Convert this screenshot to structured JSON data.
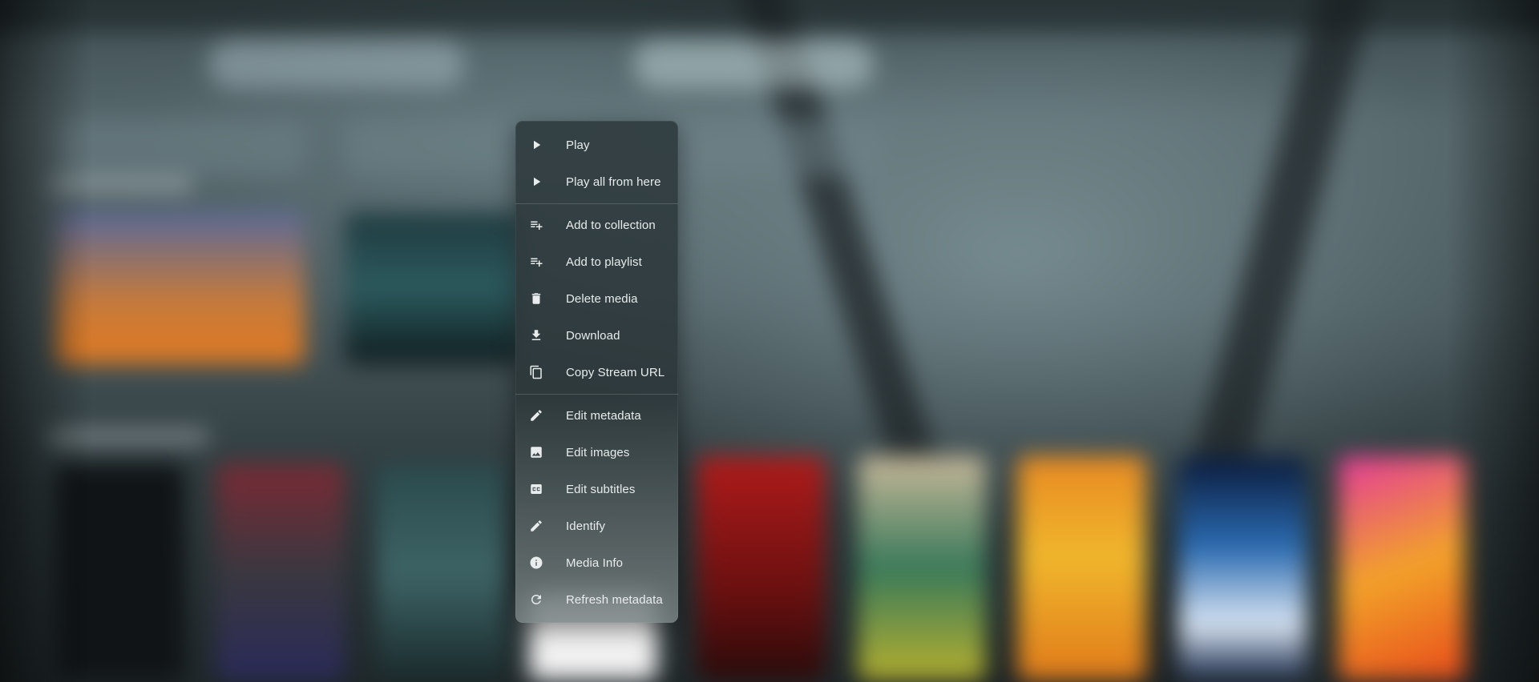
{
  "context_menu": {
    "items": [
      {
        "label": "Play",
        "icon": "play-icon"
      },
      {
        "label": "Play all from here",
        "icon": "play-icon"
      },
      {
        "label": "Add to collection",
        "icon": "playlist-add-icon"
      },
      {
        "label": "Add to playlist",
        "icon": "playlist-add-icon"
      },
      {
        "label": "Delete media",
        "icon": "trash-icon"
      },
      {
        "label": "Download",
        "icon": "download-icon"
      },
      {
        "label": "Copy Stream URL",
        "icon": "copy-icon"
      },
      {
        "label": "Edit metadata",
        "icon": "pencil-icon"
      },
      {
        "label": "Edit images",
        "icon": "image-icon"
      },
      {
        "label": "Edit subtitles",
        "icon": "closed-caption-icon"
      },
      {
        "label": "Identify",
        "icon": "pencil-icon"
      },
      {
        "label": "Media Info",
        "icon": "info-icon"
      },
      {
        "label": "Refresh metadata",
        "icon": "refresh-icon"
      }
    ]
  },
  "colors": {
    "menu_background": "#2f3b3e",
    "menu_text": "#e8ecec",
    "backdrop": "#3a4a4e"
  }
}
